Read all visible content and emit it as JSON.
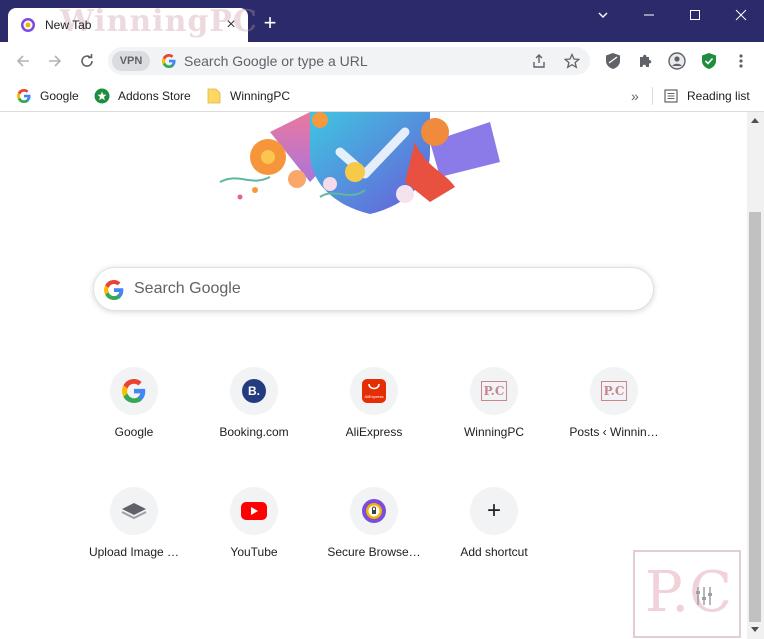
{
  "tab": {
    "title": "New Tab",
    "watermark": "WinningPC",
    "close": "×"
  },
  "new_tab_symbol": "+",
  "toolbar": {
    "vpn_label": "VPN",
    "omnibox_placeholder": "Search Google or type a URL"
  },
  "bookmarks": {
    "items": [
      {
        "label": "Google",
        "icon": "google-g-icon"
      },
      {
        "label": "Addons Store",
        "icon": "addons-store-icon"
      },
      {
        "label": "WinningPC",
        "icon": "folder-icon"
      }
    ],
    "more": "»",
    "reading_list": "Reading list"
  },
  "ntp": {
    "search_placeholder": "Search Google",
    "tiles": [
      {
        "label": "Google",
        "icon": "google-g-icon"
      },
      {
        "label": "Booking.com",
        "icon": "booking-icon"
      },
      {
        "label": "AliExpress",
        "icon": "aliexpress-icon"
      },
      {
        "label": "WinningPC",
        "icon": "winningpc-icon"
      },
      {
        "label": "Posts ‹ Winnin…",
        "icon": "winningpc-icon"
      },
      {
        "label": "Upload Image …",
        "icon": "upload-image-icon"
      },
      {
        "label": "YouTube",
        "icon": "youtube-icon"
      },
      {
        "label": "Secure Browse…",
        "icon": "secure-browser-icon"
      },
      {
        "label": "Add shortcut",
        "icon": "plus-icon"
      }
    ],
    "booking_letter": "B.",
    "aliexpress_text": "AliExpress",
    "pc_text": "P.C",
    "add_symbol": "+"
  },
  "watermark": {
    "text": "P.C"
  },
  "colors": {
    "titlebar": "#2b2b6b",
    "accent_shield": "#1e8e3e",
    "booking": "#253b80",
    "aliexpress": "#e62e04",
    "youtube": "#ff0000"
  }
}
